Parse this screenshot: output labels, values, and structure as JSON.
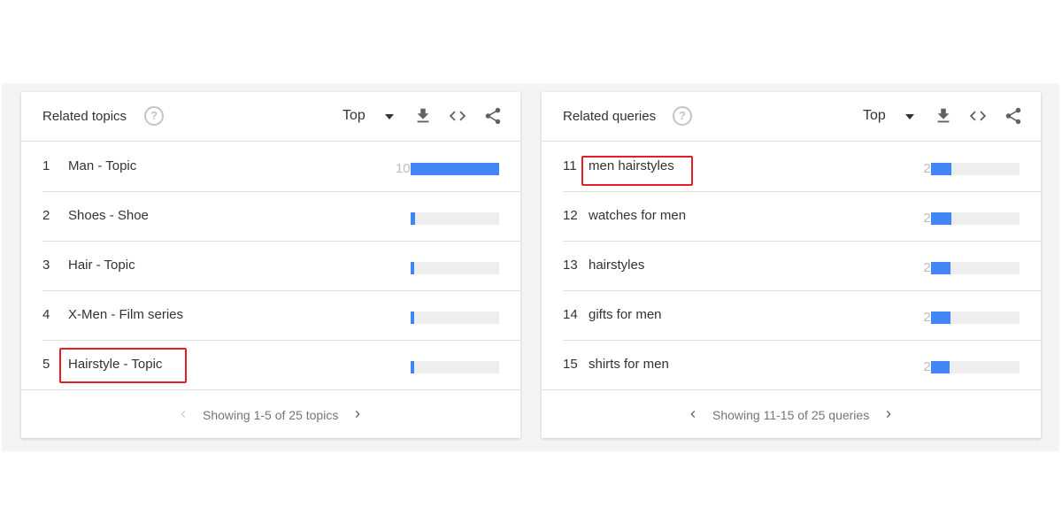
{
  "colors": {
    "bar": "#4285f4",
    "track": "#eeeeee",
    "highlight": "#e41e26"
  },
  "topics": {
    "title": "Related topics",
    "help_icon": "help-circle-icon",
    "selector": "Top",
    "icons": [
      "download-icon",
      "embed-code-icon",
      "share-icon"
    ],
    "rows": [
      {
        "rank": "1",
        "label": "Man - Topic",
        "value": "100",
        "pct": 100,
        "highlighted": false
      },
      {
        "rank": "2",
        "label": "Shoes - Shoe",
        "value": "5",
        "pct": 5,
        "highlighted": false
      },
      {
        "rank": "3",
        "label": "Hair - Topic",
        "value": "4",
        "pct": 4,
        "highlighted": false
      },
      {
        "rank": "4",
        "label": "X-Men - Film series",
        "value": "4",
        "pct": 4,
        "highlighted": false
      },
      {
        "rank": "5",
        "label": "Hairstyle - Topic",
        "value": "4",
        "pct": 4,
        "highlighted": true
      }
    ],
    "footer": "Showing 1-5 of 25 topics",
    "prev_enabled": false,
    "next_enabled": true
  },
  "queries": {
    "title": "Related queries",
    "help_icon": "help-circle-icon",
    "selector": "Top",
    "icons": [
      "download-icon",
      "embed-code-icon",
      "share-icon"
    ],
    "rows": [
      {
        "rank": "11",
        "label": "men hairstyles",
        "value": "23",
        "pct": 23,
        "highlighted": true
      },
      {
        "rank": "12",
        "label": "watches for men",
        "value": "23",
        "pct": 23,
        "highlighted": false
      },
      {
        "rank": "13",
        "label": "hairstyles",
        "value": "22",
        "pct": 22,
        "highlighted": false
      },
      {
        "rank": "14",
        "label": "gifts for men",
        "value": "22",
        "pct": 22,
        "highlighted": false
      },
      {
        "rank": "15",
        "label": "shirts for men",
        "value": "21",
        "pct": 21,
        "highlighted": false
      }
    ],
    "footer": "Showing 11-15 of 25 queries",
    "prev_enabled": true,
    "next_enabled": true
  }
}
